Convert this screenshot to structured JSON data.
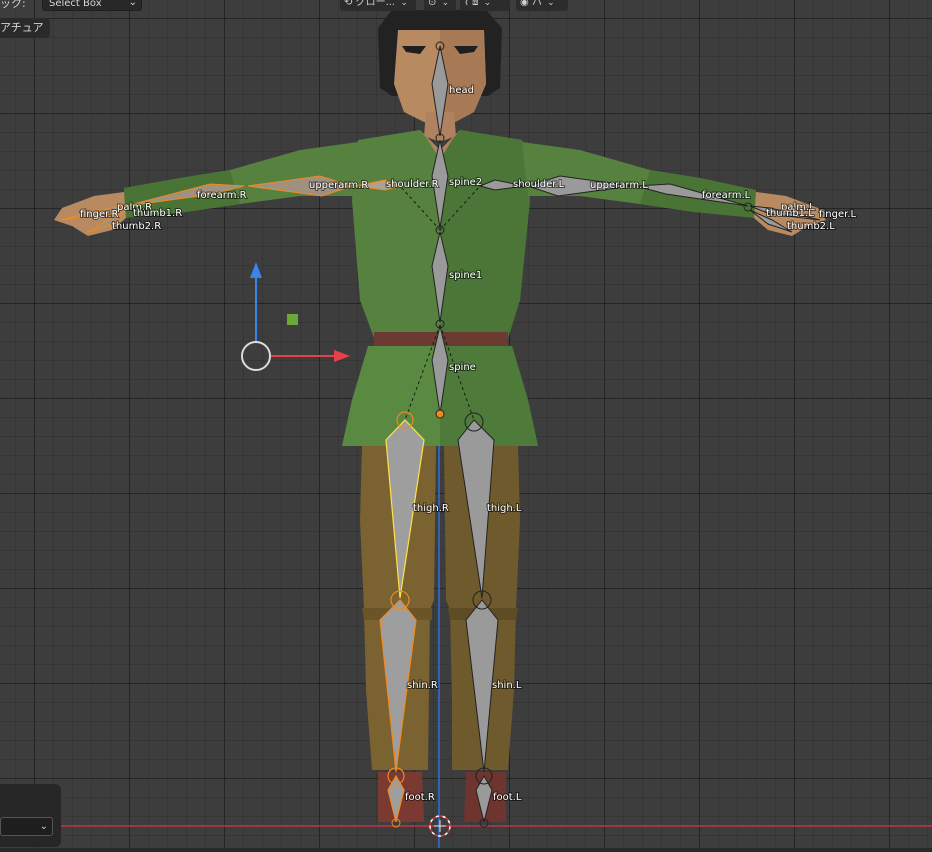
{
  "header": {
    "tool_label": "ック:",
    "select_mode": "Select Box",
    "transform_orientation": "グロー...",
    "snap_label": "",
    "mirror_label": "ハ"
  },
  "mode_label": "アチュア",
  "bones": {
    "head": "head",
    "spine2": "spine2",
    "spine1": "spine1",
    "spine": "spine",
    "shoulder_r": "shoulder.R",
    "shoulder_l": "shoulder.L",
    "upperarm_r": "upperarm.R",
    "upperarm_l": "upperarm.L",
    "forearm_r": "forearm.R",
    "forearm_l": "forearm.L",
    "palm_r": "palm.R",
    "palm_l": "palm.L",
    "finger_r": "finger.R",
    "finger_l": "finger.L",
    "thumb1_r": "thumb1.R",
    "thumb1_l": "thumb1.L",
    "thumb2_r": "thumb2.R",
    "thumb2_l": "thumb2.L",
    "thigh_r": "thigh.R",
    "thigh_l": "thigh.L",
    "shin_r": "shin.R",
    "shin_l": "shin.L",
    "foot_r": "foot.R",
    "foot_l": "foot.L"
  },
  "colors": {
    "viewport_bg": "#3d3d3d",
    "bone_selected": "#f08a1e",
    "bone_active": "#ffe14a",
    "bone_default": "#8f8f8f",
    "axis_x": "#d2343f",
    "axis_z": "#2f6fd6",
    "gizmo_x": "#e8404a",
    "gizmo_z": "#3b84e8",
    "gizmo_y_handle": "#6aa83a"
  },
  "icons": {
    "cursor": "3d-cursor-icon",
    "transform": "transform-orientation-icon",
    "pivot": "pivot-icon",
    "snap": "snap-icon",
    "proportional": "proportional-edit-icon"
  }
}
